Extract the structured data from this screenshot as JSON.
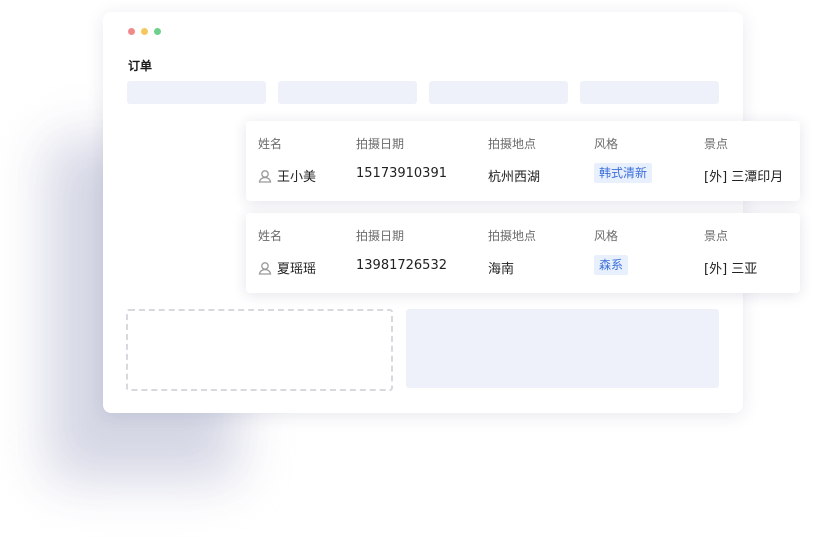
{
  "colors": {
    "dot_red": "#f08a8a",
    "dot_yellow": "#f5c85e",
    "dot_green": "#6fd08c",
    "tag_text": "#3b6fd8",
    "tag_bg": "#e9f0fd",
    "placeholder": "#eef1f9"
  },
  "window": {
    "title": "订单"
  },
  "table": {
    "headers": {
      "name": "姓名",
      "date": "拍摄日期",
      "location": "拍摄地点",
      "style": "风格",
      "spot": "景点"
    },
    "rows": [
      {
        "name": "王小美",
        "date": "15173910391",
        "location": "杭州西湖",
        "style": "韩式清新",
        "spot": "[外] 三潭印月",
        "icon": "user-icon"
      },
      {
        "name": "夏瑶瑶",
        "date": "13981726532",
        "location": "海南",
        "style": "森系",
        "spot": "[外] 三亚",
        "icon": "user-icon"
      }
    ]
  }
}
